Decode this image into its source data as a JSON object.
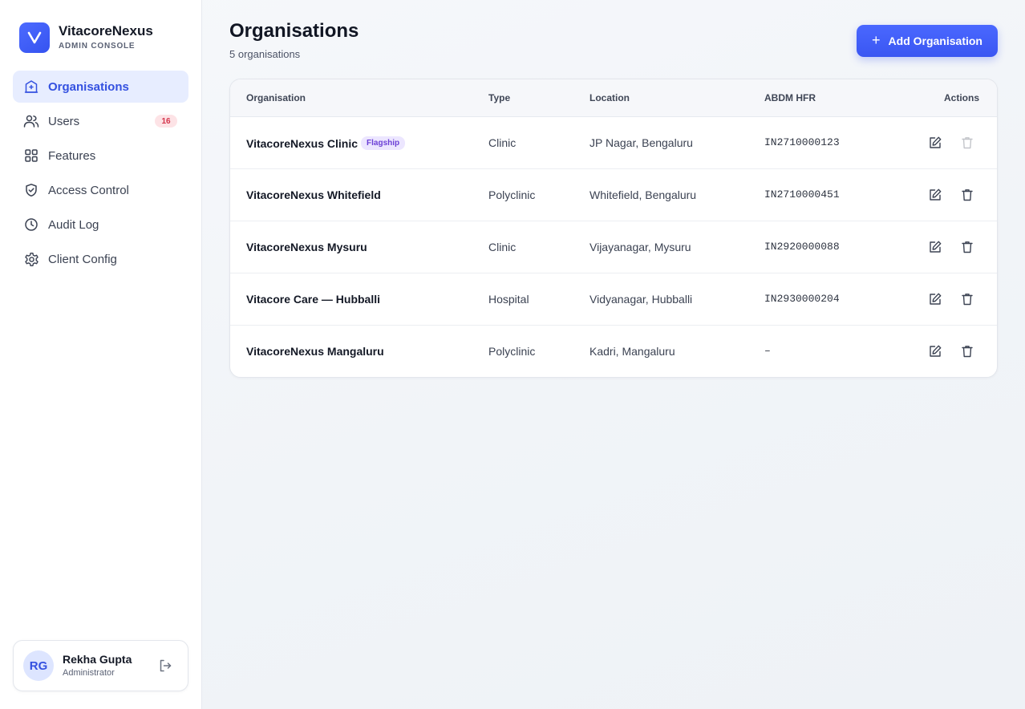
{
  "brand": {
    "name": "VitacoreNexus",
    "subtitle": "ADMIN CONSOLE",
    "logo_letter": "V"
  },
  "sidebar": {
    "items": [
      {
        "label": "Organisations",
        "icon": "building-icon",
        "active": true
      },
      {
        "label": "Users",
        "icon": "users-icon",
        "badge": "16"
      },
      {
        "label": "Features",
        "icon": "grid-icon"
      },
      {
        "label": "Access Control",
        "icon": "shield-check-icon"
      },
      {
        "label": "Audit Log",
        "icon": "clock-icon"
      },
      {
        "label": "Client Config",
        "icon": "gear-icon"
      }
    ]
  },
  "user": {
    "initials": "RG",
    "name": "Rekha Gupta",
    "role": "Administrator"
  },
  "main": {
    "title": "Organisations",
    "subtitle": "5 organisations",
    "add_button_label": "Add Organisation"
  },
  "table": {
    "columns": {
      "organisation": "Organisation",
      "type": "Type",
      "location": "Location",
      "hfr": "ABDM HFR",
      "actions": "Actions"
    },
    "rows": [
      {
        "name": "VitacoreNexus Clinic",
        "tag": "Flagship",
        "type": "Clinic",
        "location": "JP Nagar, Bengaluru",
        "hfr": "IN2710000123",
        "delete_disabled": true
      },
      {
        "name": "VitacoreNexus Whitefield",
        "type": "Polyclinic",
        "location": "Whitefield, Bengaluru",
        "hfr": "IN2710000451"
      },
      {
        "name": "VitacoreNexus Mysuru",
        "type": "Clinic",
        "location": "Vijayanagar, Mysuru",
        "hfr": "IN2920000088"
      },
      {
        "name": "Vitacore Care — Hubballi",
        "type": "Hospital",
        "location": "Vidyanagar, Hubballi",
        "hfr": "IN2930000204"
      },
      {
        "name": "VitacoreNexus Mangaluru",
        "type": "Polyclinic",
        "location": "Kadri, Mangaluru",
        "hfr": "–"
      }
    ]
  },
  "colors": {
    "accent": "#3a56f2",
    "active_nav_bg": "#e7edff",
    "badge_red": "#d4334a",
    "tag_purple": "#6b3fd6"
  }
}
